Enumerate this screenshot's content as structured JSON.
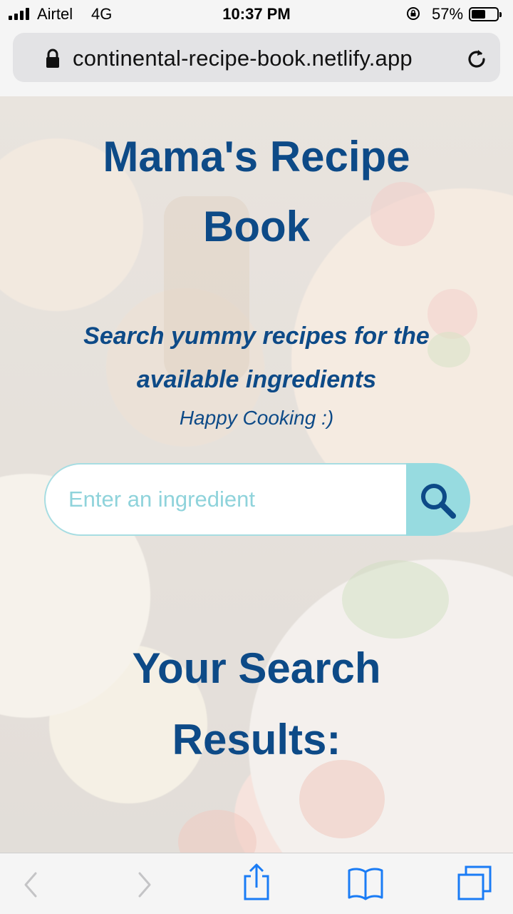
{
  "status_bar": {
    "carrier": "Airtel",
    "network": "4G",
    "time": "10:37 PM",
    "battery_percent": "57%",
    "battery_level": 0.57
  },
  "browser": {
    "url": "continental-recipe-book.netlify.app"
  },
  "page": {
    "title_line1": "Mama's Recipe",
    "title_line2": "Book",
    "subtitle_line1": "Search yummy recipes for the",
    "subtitle_line2": "available ingredients",
    "tagline": "Happy Cooking :)",
    "search": {
      "placeholder": "Enter an ingredient",
      "value": ""
    },
    "results_line1": "Your Search",
    "results_line2": "Results:"
  },
  "colors": {
    "heading": "#0d4a87",
    "search_accent": "#97dbe0",
    "ios_blue": "#1a7cf5"
  },
  "icons": {
    "search": "magnifier-icon",
    "back": "chevron-left-icon",
    "forward": "chevron-right-icon",
    "share": "share-icon",
    "bookmarks": "book-icon",
    "tabs": "tabs-icon"
  }
}
